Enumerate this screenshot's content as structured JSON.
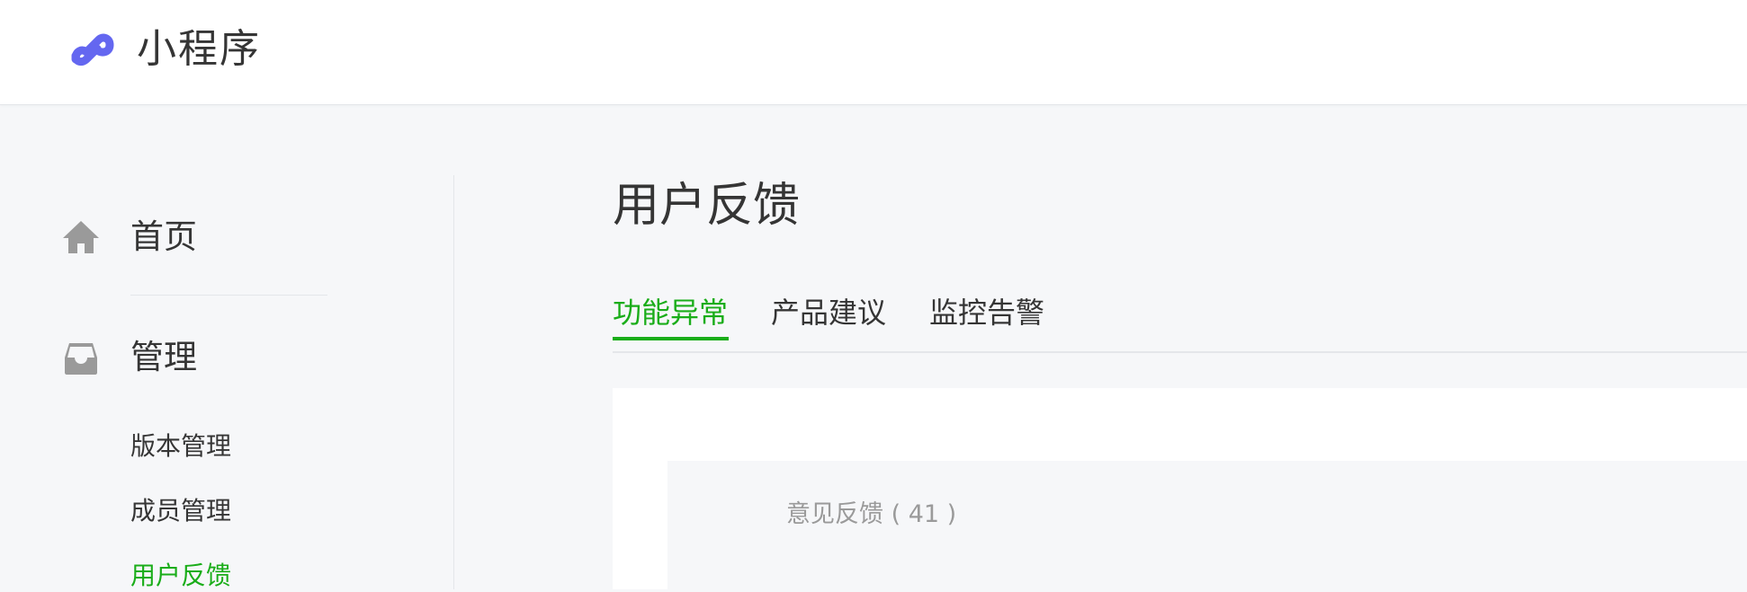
{
  "app": {
    "name": "小程序"
  },
  "sidebar": {
    "home_label": "首页",
    "manage_label": "管理",
    "sub_items": [
      {
        "label": "版本管理",
        "active": false
      },
      {
        "label": "成员管理",
        "active": false
      },
      {
        "label": "用户反馈",
        "active": true
      }
    ]
  },
  "main": {
    "title": "用户反馈",
    "tabs": [
      {
        "label": "功能异常",
        "active": true
      },
      {
        "label": "产品建议",
        "active": false
      },
      {
        "label": "监控告警",
        "active": false
      }
    ],
    "feedback_count_label": "意见反馈 ( 41 )"
  },
  "colors": {
    "accent": "#1aad19",
    "logo": "#6467f0",
    "icon_gray": "#9a9a9a",
    "text": "#353535",
    "muted_text": "#9a9a9a",
    "background": "#f6f7f9"
  },
  "icons": {
    "logo": "mini-program-logo-icon",
    "home": "home-icon",
    "manage": "inbox-tray-icon"
  }
}
